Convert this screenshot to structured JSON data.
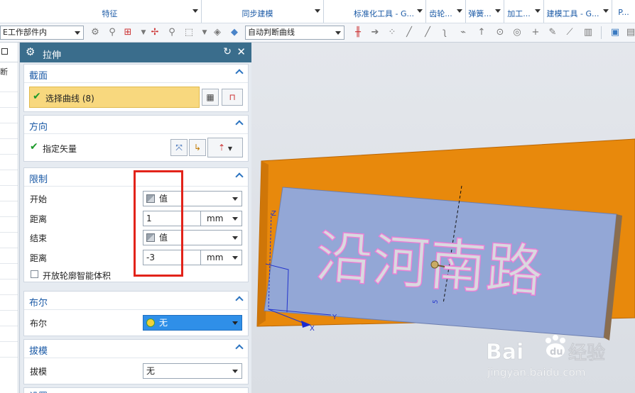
{
  "ribbon_groups": [
    {
      "label": "特征"
    },
    {
      "label": "同步建模"
    },
    {
      "label": "标准化工具 - G..."
    },
    {
      "label": "齿轮..."
    },
    {
      "label": "弹簧..."
    },
    {
      "label": "加工..."
    },
    {
      "label": "建模工具 - G..."
    },
    {
      "label": "P..."
    }
  ],
  "toolbar": {
    "scope_combo": "E工作部件内",
    "curve_rule_combo": "自动判断曲线"
  },
  "left_strip": {
    "fragment": "断"
  },
  "dialog": {
    "title": "拉伸",
    "section": {
      "header": "截面",
      "select_curve": "选择曲线 (8)"
    },
    "direction": {
      "header": "方向",
      "specify_vector": "指定矢量"
    },
    "limits": {
      "header": "限制",
      "start_label": "开始",
      "start_value": "值",
      "distance1_label": "距离",
      "distance1_value": "1",
      "distance1_unit": "mm",
      "end_label": "结束",
      "end_value": "值",
      "distance2_label": "距离",
      "distance2_value": "-3",
      "distance2_unit": "mm",
      "open_profile_label": "开放轮廓智能体积"
    },
    "boolean": {
      "header": "布尔",
      "label": "布尔",
      "value": "无"
    },
    "draft": {
      "header": "拔模",
      "label": "拔模",
      "value": "无"
    },
    "next_header": "设置"
  },
  "viewport": {
    "text": "沿河南路",
    "axis_z": "Z",
    "axis_x": "X",
    "axis_y": "Y",
    "dim_label": "5"
  },
  "watermark": {
    "brand_left": "Bai",
    "brand_right": "经验",
    "url": "jingyan.baidu.com"
  },
  "colors": {
    "dialog_title_bg": "#3a6d8c",
    "section_header_text": "#1b5aa6",
    "selected_curve_bg": "#f8d87e",
    "highlight_box": "#e2231a",
    "frame_orange": "#e8890c",
    "plate_blue": "#93a7d6",
    "boolean_selected_bg": "#2f8fe8"
  }
}
